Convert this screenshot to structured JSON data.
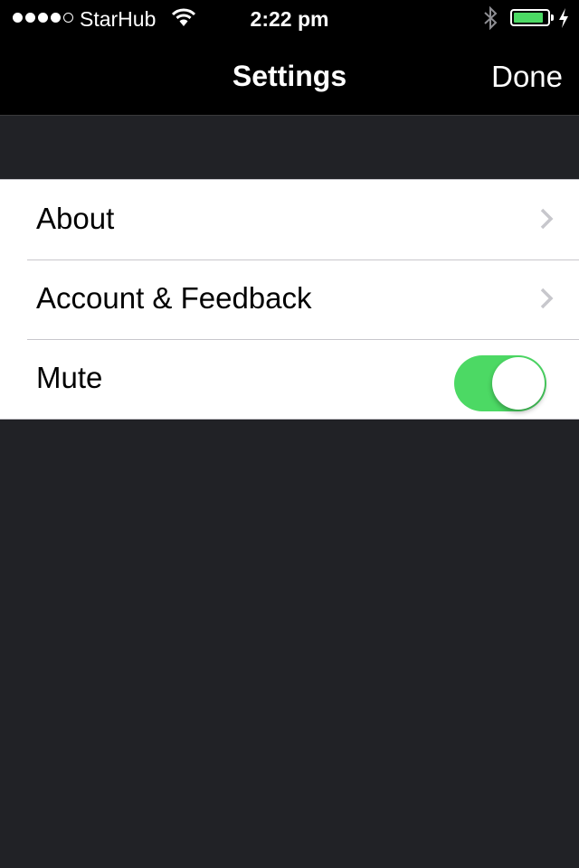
{
  "status_bar": {
    "signal_bars_filled": 4,
    "signal_bars_total": 5,
    "carrier": "StarHub",
    "time": "2:22 pm",
    "battery_level_percent": 90,
    "charging": true,
    "icons": [
      "signal-icon",
      "wifi-icon",
      "bluetooth-icon",
      "battery-icon",
      "charging-bolt-icon"
    ]
  },
  "nav": {
    "title": "Settings",
    "done_label": "Done"
  },
  "settings": {
    "items": [
      {
        "label": "About",
        "accessory": "chevron"
      },
      {
        "label": "Account & Feedback",
        "accessory": "chevron"
      },
      {
        "label": "Mute",
        "accessory": "toggle",
        "value": true
      }
    ]
  },
  "colors": {
    "toggle_on": "#4cd964",
    "battery": "#4cd964",
    "background": "#212226"
  }
}
